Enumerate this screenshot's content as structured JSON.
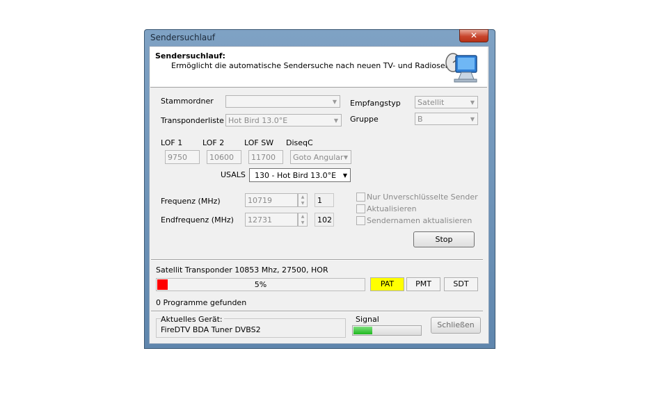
{
  "window": {
    "title": "Sendersuchlauf",
    "close_glyph": "✕"
  },
  "header": {
    "title": "Sendersuchlauf:",
    "subtitle": "Ermöglicht die automatische Sendersuche nach neuen TV- und Radiosendern.",
    "icon": "monitor-satellite-icon"
  },
  "form": {
    "stammordner_label": "Stammordner",
    "stammordner_value": "",
    "transponderliste_label": "Transponderliste",
    "transponderliste_value": "Hot Bird 13.0°E",
    "empfangstyp_label": "Empfangstyp",
    "empfangstyp_value": "Satellit",
    "gruppe_label": "Gruppe",
    "gruppe_value": "B",
    "lof1_label": "LOF 1",
    "lof1_value": "9750",
    "lof2_label": "LOF 2",
    "lof2_value": "10600",
    "lofsw_label": "LOF SW",
    "lofsw_value": "11700",
    "diseqc_label": "DiseqC",
    "diseqc_value": "Goto Angular",
    "usals_label": "USALS",
    "usals_value": "130 - Hot Bird 13.0°E",
    "frequenz_label": "Frequenz (MHz)",
    "frequenz_value": "10719",
    "frequenz_index": "1",
    "endfrequenz_label": "Endfrequenz (MHz)",
    "endfrequenz_value": "12731",
    "endfrequenz_index": "102",
    "check_unencrypted": "Nur Unverschlüsselte Sender",
    "check_update": "Aktualisieren",
    "check_names": "Sendernamen aktualisieren",
    "stop_button": "Stop"
  },
  "status": {
    "transponder_text": "Satellit Transponder 10853 Mhz, 27500, HOR",
    "progress_percent": 5,
    "progress_label": "5%",
    "pat_label": "PAT",
    "pmt_label": "PMT",
    "sdt_label": "SDT",
    "found_text": "0 Programme gefunden"
  },
  "device": {
    "group_label": "Aktuelles Gerät:",
    "device_name": "FireDTV BDA Tuner DVBS2",
    "signal_label": "Signal",
    "signal_level": 0.28,
    "close_button": "Schließen"
  },
  "colors": {
    "pat_active": "#ffff00",
    "progress_fill": "#ff0000",
    "signal_fill": "#22bb22"
  }
}
